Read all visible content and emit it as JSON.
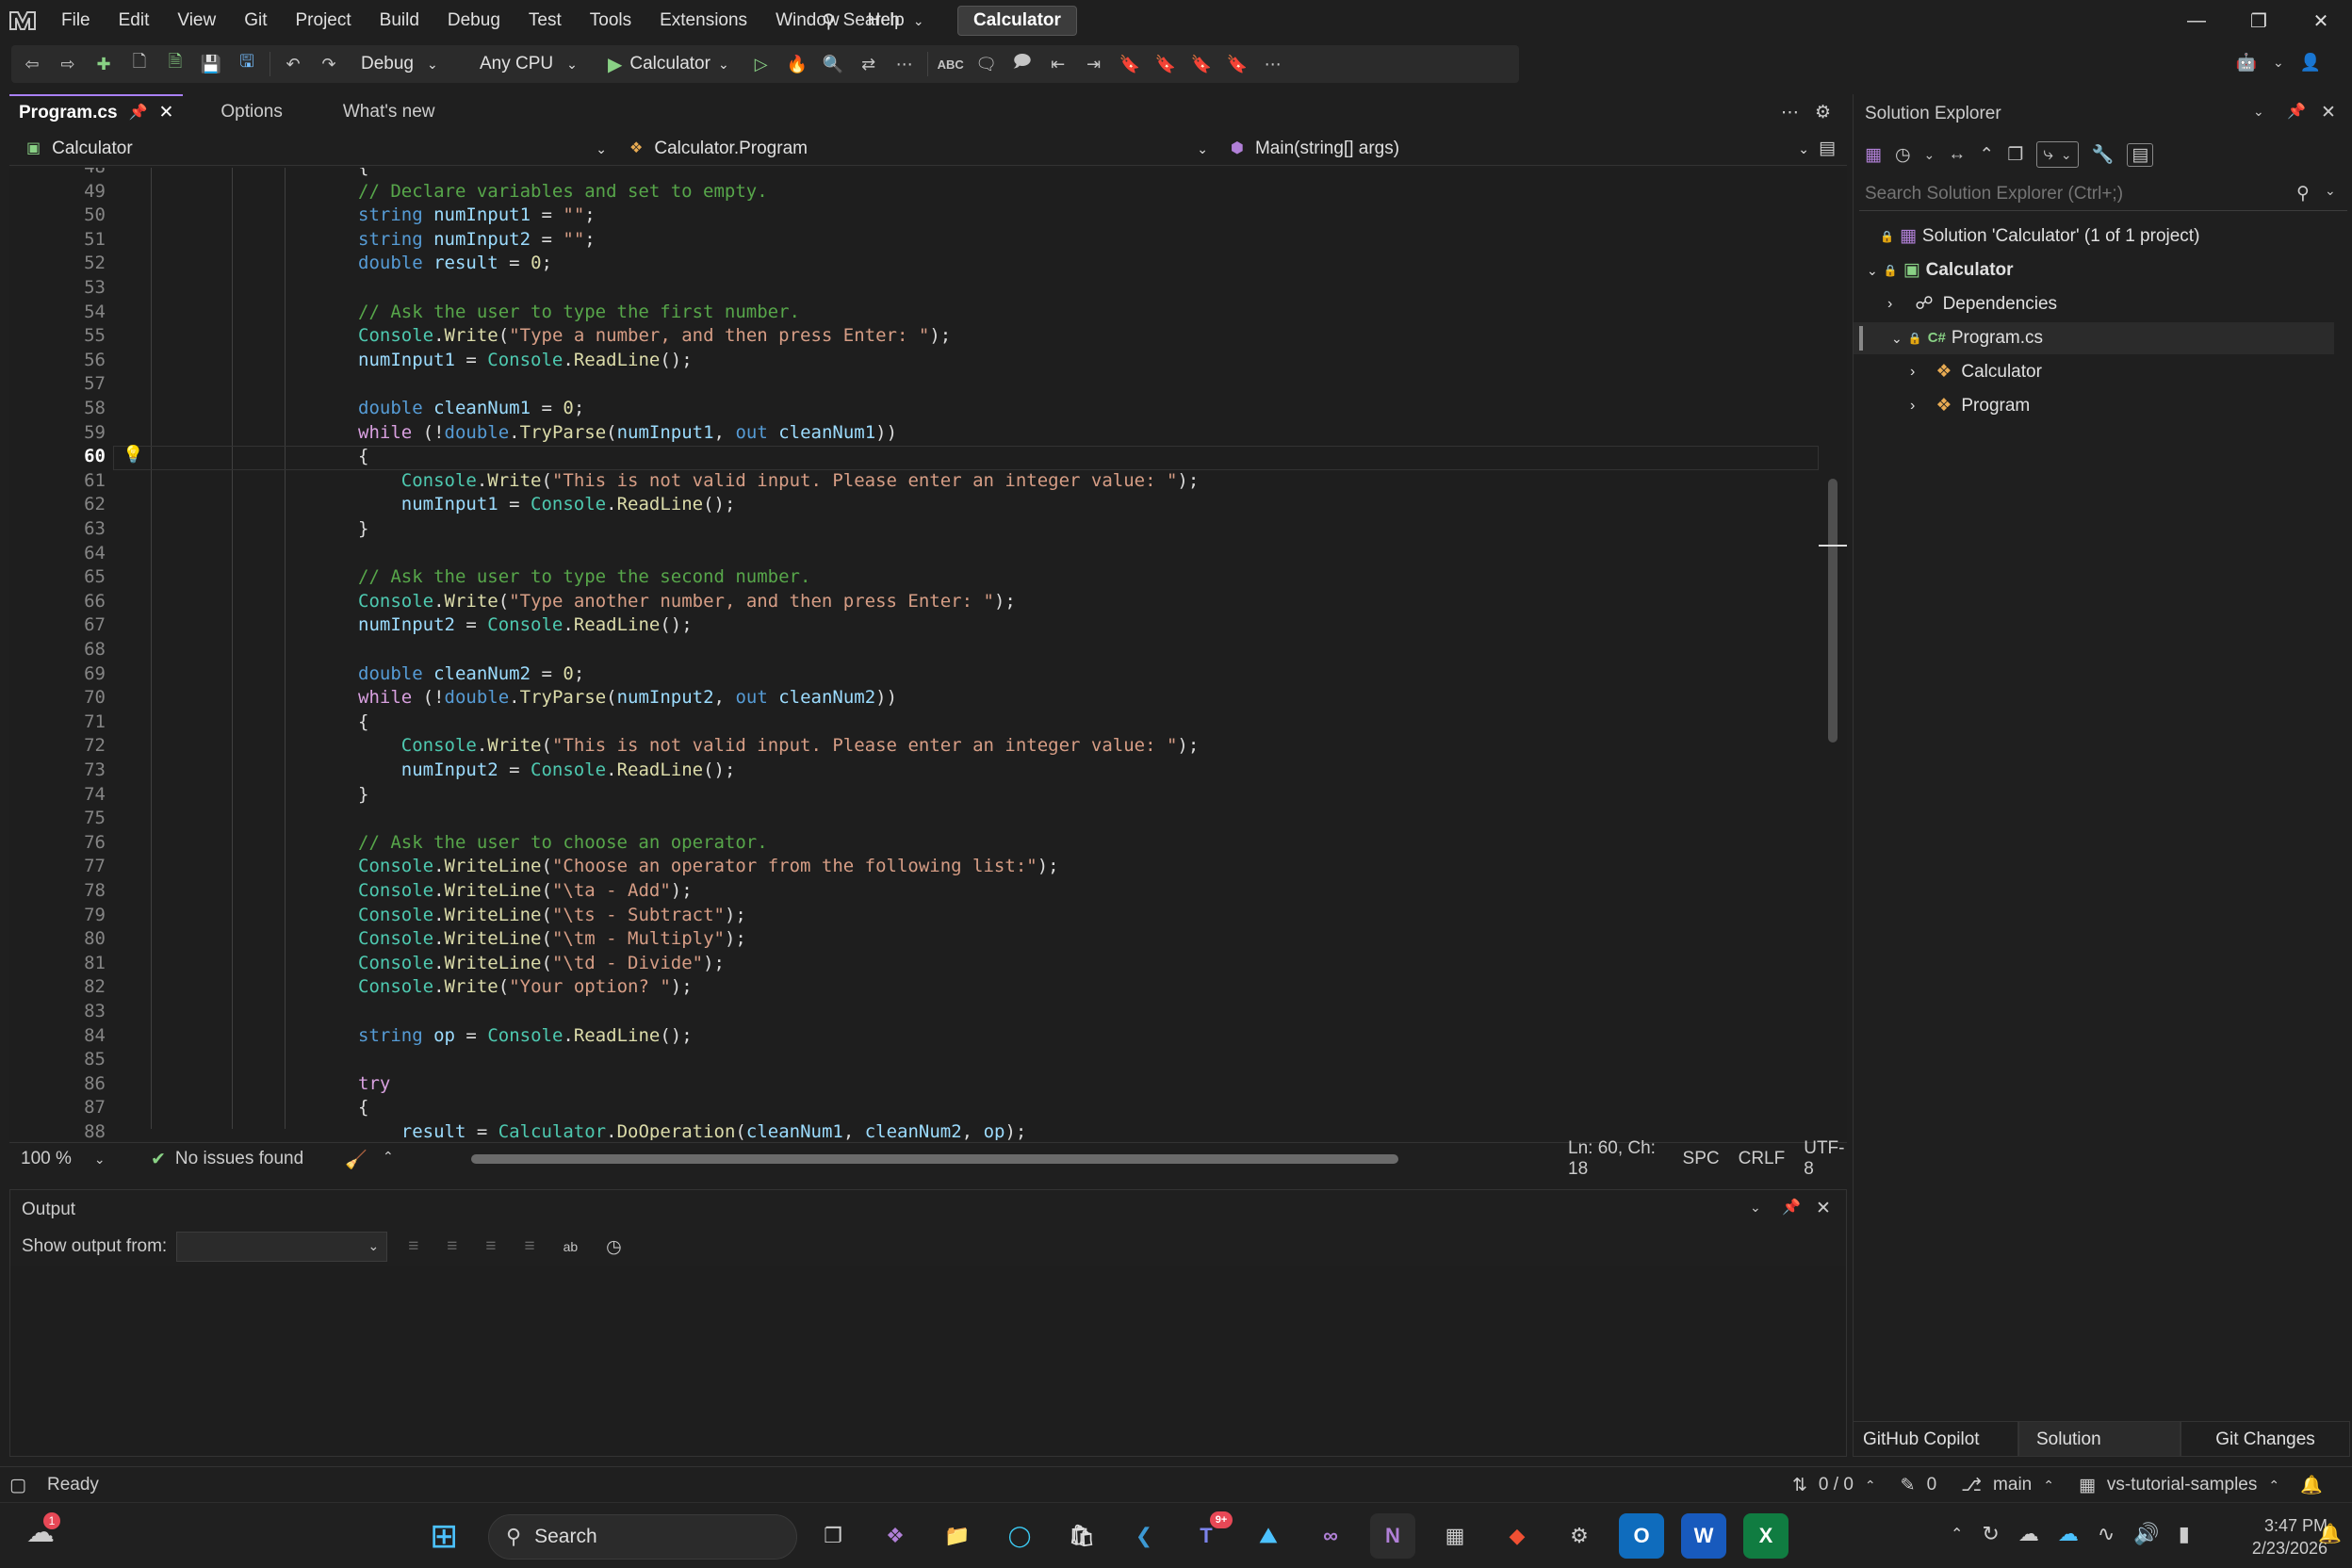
{
  "menu": [
    "File",
    "Edit",
    "View",
    "Git",
    "Project",
    "Build",
    "Debug",
    "Test",
    "Tools",
    "Extensions",
    "Window",
    "Help"
  ],
  "search_label": "Search",
  "solution_badge": "Calculator",
  "toolbar": {
    "config": "Debug",
    "platform": "Any CPU",
    "start_target": "Calculator"
  },
  "tabs": [
    {
      "label": "Program.cs",
      "active": true
    },
    {
      "label": "Options"
    },
    {
      "label": "What's new"
    }
  ],
  "navbar": {
    "project": "Calculator",
    "type": "Calculator.Program",
    "member": "Main(string[] args)"
  },
  "code_lines": [
    {
      "n": "48",
      "html": "{"
    },
    {
      "n": "49",
      "html": "<span class='ct'>// Declare variables and set to empty.</span>"
    },
    {
      "n": "50",
      "html": "<span class='kw'>string</span> <span class='var'>numInput1</span> = <span class='str'>\"\"</span>;"
    },
    {
      "n": "51",
      "html": "<span class='kw'>string</span> <span class='var'>numInput2</span> = <span class='str'>\"\"</span>;"
    },
    {
      "n": "52",
      "html": "<span class='kw'>double</span> <span class='var'>result</span> = <span class='mth'>0</span>;"
    },
    {
      "n": "53",
      "html": ""
    },
    {
      "n": "54",
      "html": "<span class='ct'>// Ask the user to type the first number.</span>"
    },
    {
      "n": "55",
      "html": "<span class='cls'>Console</span>.<span class='mth'>Write</span>(<span class='str'>\"Type a number, and then press Enter: \"</span>);"
    },
    {
      "n": "56",
      "html": "<span class='var'>numInput1</span> = <span class='cls'>Console</span>.<span class='mth'>ReadLine</span>();"
    },
    {
      "n": "57",
      "html": ""
    },
    {
      "n": "58",
      "html": "<span class='kw'>double</span> <span class='var'>cleanNum1</span> = <span class='mth'>0</span>;"
    },
    {
      "n": "59",
      "html": "<span class='ctl'>while</span> (!<span class='kw'>double</span>.<span class='mth'>TryParse</span>(<span class='var'>numInput1</span>, <span class='kw'>out</span> <span class='var'>cleanNum1</span>))"
    },
    {
      "n": "60",
      "html": "{",
      "cur": true
    },
    {
      "n": "61",
      "html": "    <span class='cls'>Console</span>.<span class='mth'>Write</span>(<span class='str'>\"This is not valid input. Please enter an integer value: \"</span>);"
    },
    {
      "n": "62",
      "html": "    <span class='var'>numInput1</span> = <span class='cls'>Console</span>.<span class='mth'>ReadLine</span>();"
    },
    {
      "n": "63",
      "html": "}"
    },
    {
      "n": "64",
      "html": ""
    },
    {
      "n": "65",
      "html": "<span class='ct'>// Ask the user to type the second number.</span>"
    },
    {
      "n": "66",
      "html": "<span class='cls'>Console</span>.<span class='mth'>Write</span>(<span class='str'>\"Type another number, and then press Enter: \"</span>);"
    },
    {
      "n": "67",
      "html": "<span class='var'>numInput2</span> = <span class='cls'>Console</span>.<span class='mth'>ReadLine</span>();"
    },
    {
      "n": "68",
      "html": ""
    },
    {
      "n": "69",
      "html": "<span class='kw'>double</span> <span class='var'>cleanNum2</span> = <span class='mth'>0</span>;"
    },
    {
      "n": "70",
      "html": "<span class='ctl'>while</span> (!<span class='kw'>double</span>.<span class='mth'>TryParse</span>(<span class='var'>numInput2</span>, <span class='kw'>out</span> <span class='var'>cleanNum2</span>))"
    },
    {
      "n": "71",
      "html": "{"
    },
    {
      "n": "72",
      "html": "    <span class='cls'>Console</span>.<span class='mth'>Write</span>(<span class='str'>\"This is not valid input. Please enter an integer value: \"</span>);"
    },
    {
      "n": "73",
      "html": "    <span class='var'>numInput2</span> = <span class='cls'>Console</span>.<span class='mth'>ReadLine</span>();"
    },
    {
      "n": "74",
      "html": "}"
    },
    {
      "n": "75",
      "html": ""
    },
    {
      "n": "76",
      "html": "<span class='ct'>// Ask the user to choose an operator.</span>"
    },
    {
      "n": "77",
      "html": "<span class='cls'>Console</span>.<span class='mth'>WriteLine</span>(<span class='str'>\"Choose an operator from the following list:\"</span>);"
    },
    {
      "n": "78",
      "html": "<span class='cls'>Console</span>.<span class='mth'>WriteLine</span>(<span class='str'>\"\\ta - Add\"</span>);"
    },
    {
      "n": "79",
      "html": "<span class='cls'>Console</span>.<span class='mth'>WriteLine</span>(<span class='str'>\"\\ts - Subtract\"</span>);"
    },
    {
      "n": "80",
      "html": "<span class='cls'>Console</span>.<span class='mth'>WriteLine</span>(<span class='str'>\"\\tm - Multiply\"</span>);"
    },
    {
      "n": "81",
      "html": "<span class='cls'>Console</span>.<span class='mth'>WriteLine</span>(<span class='str'>\"\\td - Divide\"</span>);"
    },
    {
      "n": "82",
      "html": "<span class='cls'>Console</span>.<span class='mth'>Write</span>(<span class='str'>\"Your option? \"</span>);"
    },
    {
      "n": "83",
      "html": ""
    },
    {
      "n": "84",
      "html": "<span class='kw'>string</span> <span class='var'>op</span> = <span class='cls'>Console</span>.<span class='mth'>ReadLine</span>();"
    },
    {
      "n": "85",
      "html": ""
    },
    {
      "n": "86",
      "html": "<span class='ctl'>try</span>"
    },
    {
      "n": "87",
      "html": "{"
    },
    {
      "n": "88",
      "html": "    <span class='var'>result</span> = <span class='cls'>Calculator</span>.<span class='mth'>DoOperation</span>(<span class='var'>cleanNum1</span>, <span class='var'>cleanNum2</span>, <span class='var'>op</span>);"
    }
  ],
  "editor_status": {
    "zoom": "100 %",
    "issues": "No issues found",
    "position": "Ln: 60, Ch: 18",
    "indent": "SPC",
    "eol": "CRLF",
    "encoding": "UTF-8"
  },
  "output": {
    "title": "Output",
    "show_from_label": "Show output from:"
  },
  "solution_explorer": {
    "title": "Solution Explorer",
    "search_placeholder": "Search Solution Explorer (Ctrl+;)",
    "items": [
      {
        "label": "Solution 'Calculator' (1 of 1 project)"
      },
      {
        "label": "Calculator"
      },
      {
        "label": "Dependencies"
      },
      {
        "label": "Program.cs"
      },
      {
        "label": "Calculator"
      },
      {
        "label": "Program"
      }
    ],
    "bottom_tabs": [
      "GitHub Copilot C...",
      "Solution Explorer",
      "Git Changes"
    ]
  },
  "statusbar": {
    "ready": "Ready",
    "sync": "0 / 0",
    "edits": "0",
    "branch": "main",
    "repo": "vs-tutorial-samples"
  },
  "taskbar": {
    "search": "Search",
    "time": "3:47 PM",
    "date": "2/23/2026",
    "teams_badge": "9+"
  }
}
